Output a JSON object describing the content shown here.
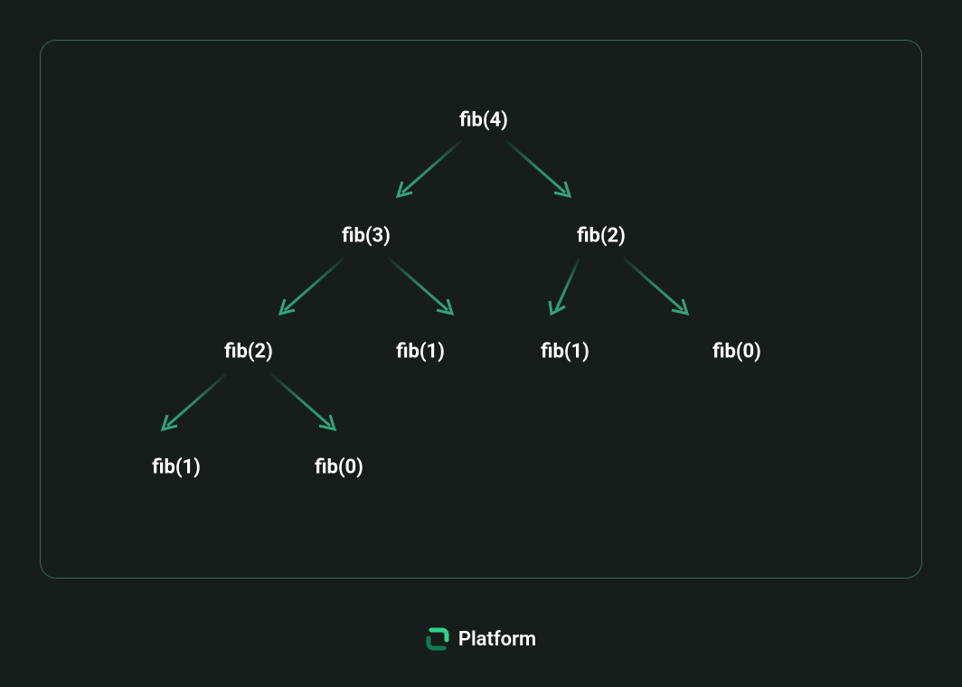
{
  "diagram": {
    "root": "fib(4)",
    "left": {
      "label": "fib(3)",
      "left": "fib(2)",
      "left_children": {
        "left": "fib(1)",
        "right": "fib(0)"
      },
      "right": "fib(1)"
    },
    "right": {
      "label": "fib(2)",
      "left": "fib(1)",
      "right": "fib(0)"
    }
  },
  "footer": {
    "brand": "Platform"
  },
  "colors": {
    "bg": "#171d1a",
    "border": "#2f6b56",
    "arrow": "#32a47c",
    "text": "#ffffff"
  }
}
